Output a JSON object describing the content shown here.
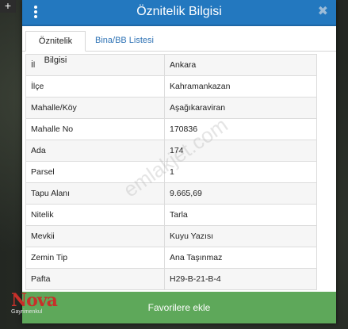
{
  "dialog": {
    "title": "Öznitelik Bilgisi",
    "close_glyph": "✖"
  },
  "tabs": [
    {
      "label": "Öznitelik Bilgisi",
      "active": true
    },
    {
      "label": "Bina/BB Listesi",
      "active": false
    }
  ],
  "attributes": [
    {
      "key": "İl",
      "value": "Ankara"
    },
    {
      "key": "İlçe",
      "value": "Kahramankazan"
    },
    {
      "key": "Mahalle/Köy",
      "value": "Aşağıkaraviran"
    },
    {
      "key": "Mahalle No",
      "value": "170836"
    },
    {
      "key": "Ada",
      "value": "174"
    },
    {
      "key": "Parsel",
      "value": "1"
    },
    {
      "key": "Tapu Alanı",
      "value": "9.665,69"
    },
    {
      "key": "Nitelik",
      "value": "Tarla"
    },
    {
      "key": "Mevkii",
      "value": "Kuyu Yazısı"
    },
    {
      "key": "Zemin Tip",
      "value": "Ana Taşınmaz"
    },
    {
      "key": "Pafta",
      "value": "H29-B-21-B-4"
    }
  ],
  "footer": {
    "button_label": "Favorilere ekle"
  },
  "logo": {
    "main": "Nova",
    "sub": "Gayrimenkul"
  },
  "watermark": "emlakjet.com",
  "colors": {
    "header": "#2378bf",
    "tab_link": "#2f73b5",
    "button": "#5ea85a",
    "logo": "#c7302a"
  }
}
